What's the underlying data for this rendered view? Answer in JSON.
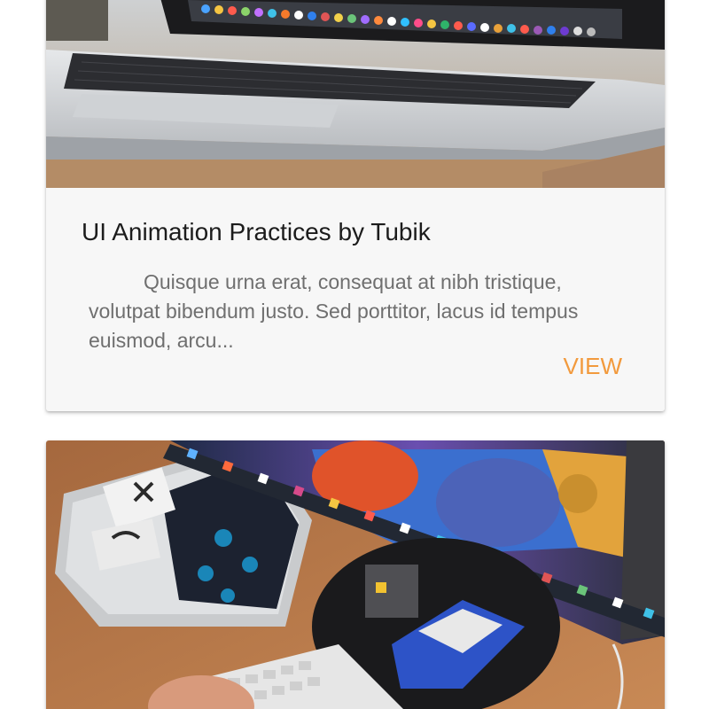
{
  "cards": [
    {
      "title": "UI Animation Practices by Tubik",
      "excerpt": "Quisque urna erat, consequat at nibh tristique, volutpat bibendum justo. Sed porttitor, lacus id tempus euismod, arcu...",
      "action_label": "VIEW",
      "image": "laptop-on-desk-photo"
    },
    {
      "image": "designer-monitor-desk-photo"
    }
  ],
  "colors": {
    "accent": "#f29a3d",
    "title": "#1c1c1c",
    "body_text": "#6f6f6f",
    "card_background": "#f7f7f7"
  }
}
